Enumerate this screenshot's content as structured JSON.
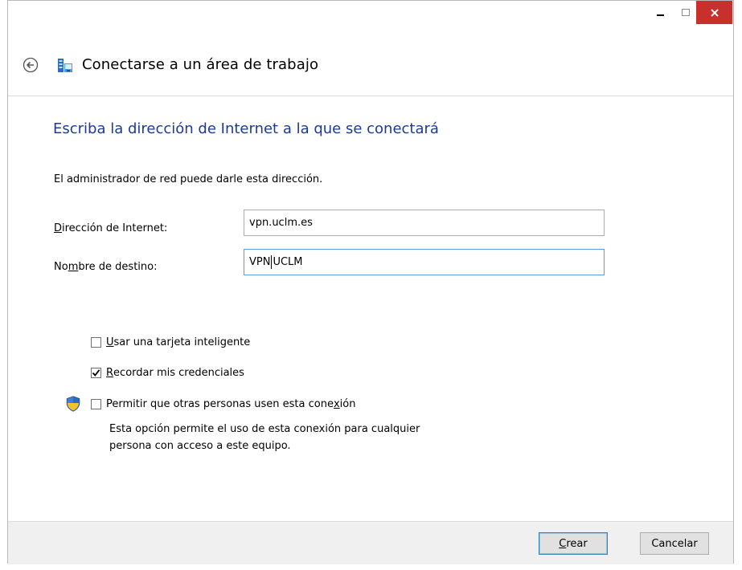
{
  "window": {
    "title": "Conectarse a un área de trabajo",
    "close_color": "#c7302c"
  },
  "icons": {
    "back": "back-arrow-icon",
    "app": "workplace-network-icon",
    "shield": "uac-shield-icon",
    "minimize": "minimize-icon",
    "maximize": "maximize-icon",
    "close": "close-icon"
  },
  "main": {
    "heading": "Escriba la dirección de Internet a la que se conectará",
    "info": "El administrador de red puede darle esta dirección.",
    "address_label_u": "D",
    "address_label_rest": "irección de Internet:",
    "address_value": "vpn.uclm.es",
    "dest_label_pre": "No",
    "dest_label_u": "m",
    "dest_label_post": "bre de destino:",
    "dest_value_before_caret": "VPN",
    "dest_value_after_caret": "UCLM"
  },
  "options": {
    "smartcard_u": "U",
    "smartcard_rest": "sar una tarjeta inteligente",
    "smartcard_checked": false,
    "remember_u": "R",
    "remember_rest": "ecordar mis credenciales",
    "remember_checked": true,
    "allow_pre": "Permitir que otras personas usen esta cone",
    "allow_u": "x",
    "allow_post": "ión",
    "allow_checked": false,
    "allow_desc_line1": "Esta opción permite el uso de esta conexión para cualquier",
    "allow_desc_line2": "persona con acceso a este equipo."
  },
  "footer": {
    "create_u": "C",
    "create_rest": "rear",
    "cancel": "Cancelar"
  },
  "colors": {
    "heading": "#1c3a98",
    "focus_border": "#569de5",
    "footer_bg": "#f0f0f0"
  }
}
